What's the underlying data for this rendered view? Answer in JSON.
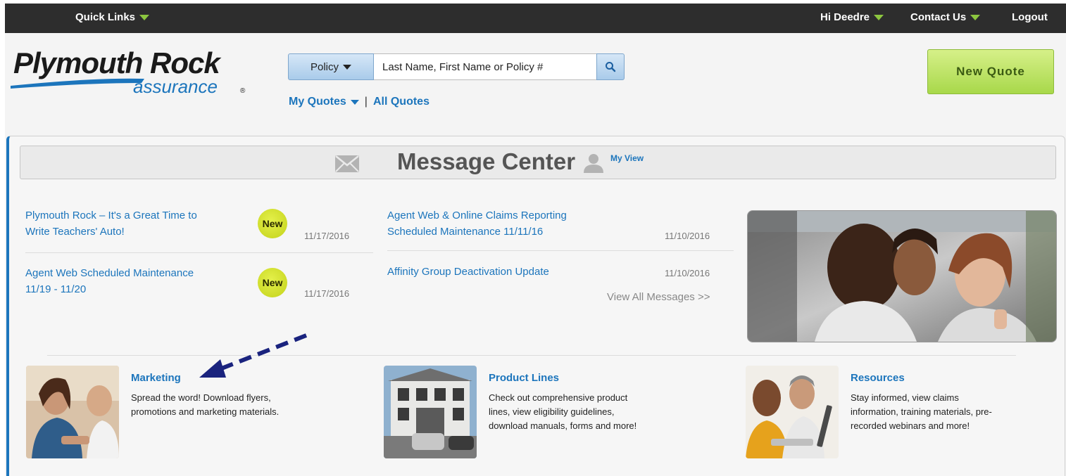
{
  "topbar": {
    "quick_links": "Quick Links",
    "greeting": "Hi Deedre",
    "contact_us": "Contact Us",
    "logout": "Logout"
  },
  "brand": {
    "name": "Plymouth Rock",
    "sub": "assurance",
    "reg": "®"
  },
  "search": {
    "scope_label": "Policy",
    "placeholder": "Last Name, First Name or Policy #"
  },
  "quotes": {
    "my_quotes": "My Quotes",
    "separator": "|",
    "all_quotes": "All Quotes"
  },
  "new_quote_label": "New Quote",
  "message_center": {
    "title": "Message Center",
    "my_view": "My View",
    "messages_left": [
      {
        "title_line1": "Plymouth Rock – It's a Great Time to",
        "title_line2": "Write Teachers' Auto!",
        "badge": "New",
        "date": "11/17/2016"
      },
      {
        "title_line1": "Agent Web Scheduled Maintenance",
        "title_line2": "11/19 - 11/20",
        "badge": "New",
        "date": "11/17/2016"
      }
    ],
    "messages_right": [
      {
        "title_line1": "Agent Web & Online Claims Reporting",
        "title_line2": "Scheduled Maintenance 11/11/16",
        "date": "11/10/2016"
      },
      {
        "title_line1": "Affinity Group Deactivation Update",
        "title_line2": "",
        "date": "11/10/2016"
      }
    ],
    "view_all": "View All Messages >>"
  },
  "cards": [
    {
      "title": "Marketing",
      "line1": "Spread the word! Download flyers,",
      "line2": "promotions and marketing materials.",
      "line3": ""
    },
    {
      "title": "Product Lines",
      "line1": "Check out comprehensive product",
      "line2": "lines, view eligibility guidelines,",
      "line3": "download manuals, forms and more!"
    },
    {
      "title": "Resources",
      "line1": "Stay informed, view claims",
      "line2": "information, training materials, pre-",
      "line3": "recorded webinars and more!"
    }
  ],
  "colors": {
    "link_blue": "#1c75bc",
    "accent_green": "#8cc63f",
    "topbar_bg": "#2d2d2d",
    "arrow": "#1a237e"
  }
}
